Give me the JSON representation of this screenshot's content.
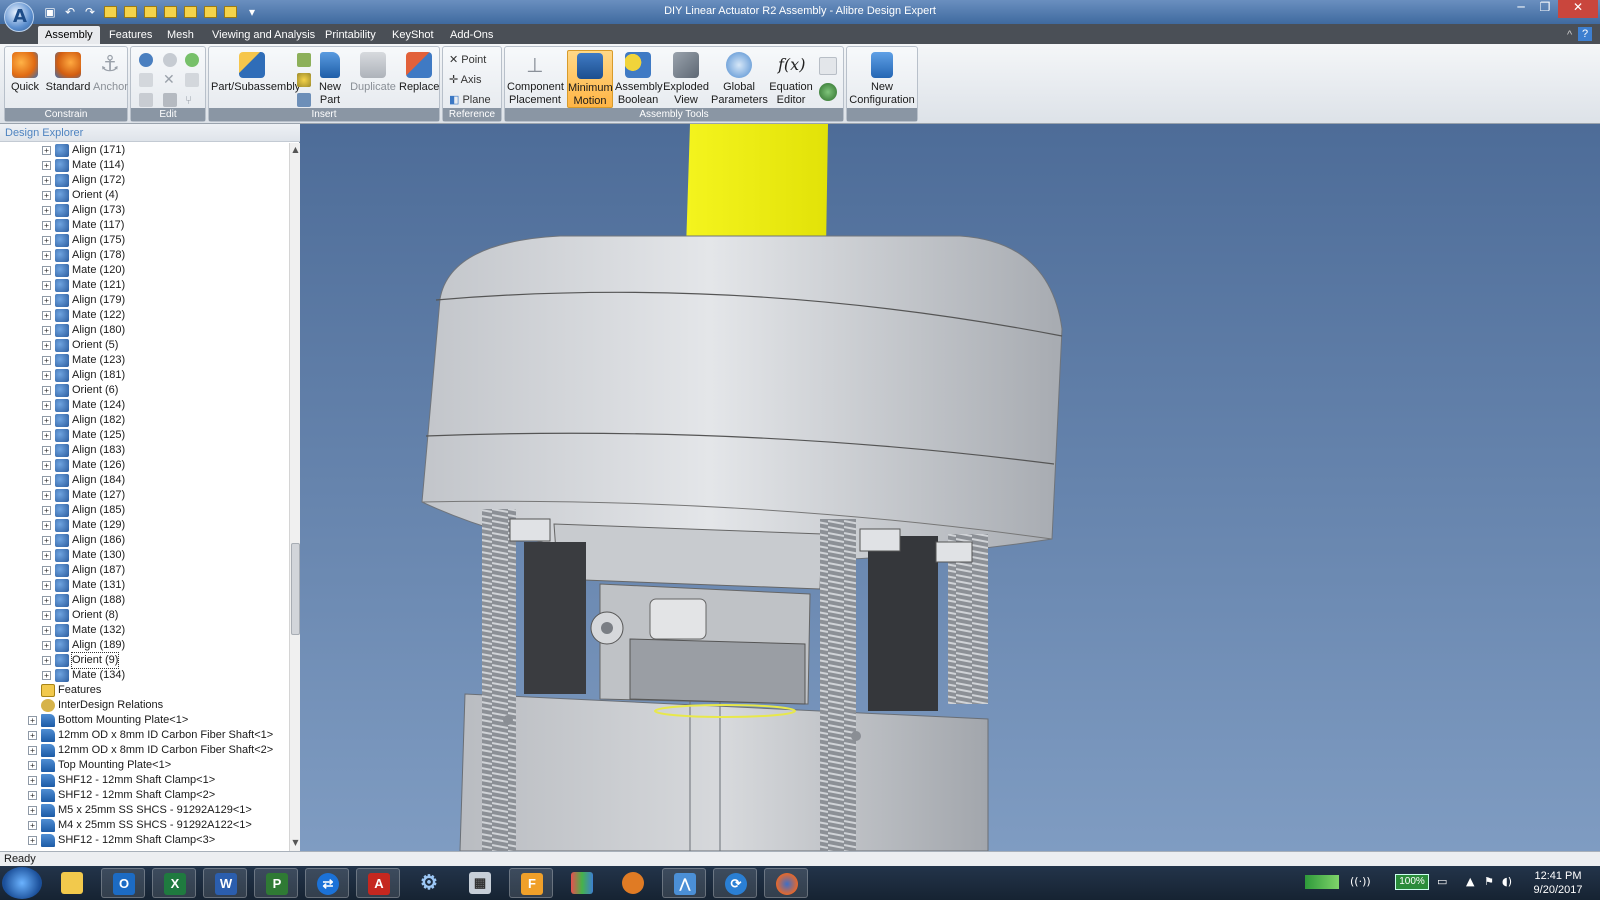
{
  "window": {
    "title": "DIY Linear Actuator R2 Assembly - Alibre Design Expert",
    "logo_icon": "alibre-logo-icon"
  },
  "menu_tabs": [
    "Assembly",
    "Features",
    "Mesh",
    "Viewing and Analysis",
    "Printability",
    "KeyShot",
    "Add-Ons"
  ],
  "active_tab": "Assembly",
  "ribbon": {
    "constrain": {
      "label": "Constrain",
      "quick": "Quick",
      "standard": "Standard",
      "anchor": "Anchor"
    },
    "edit": {
      "label": "Edit"
    },
    "insert": {
      "label": "Insert",
      "part_subassembly": "Part/Subassembly",
      "new_part_1": "New",
      "new_part_2": "Part",
      "duplicate": "Duplicate",
      "replace": "Replace"
    },
    "reference": {
      "label": "Reference",
      "point": "Point",
      "axis": "Axis",
      "plane": "Plane"
    },
    "assembly_tools": {
      "label": "Assembly Tools",
      "component_placement_1": "Component",
      "component_placement_2": "Placement",
      "minimum_motion_1": "Minimum",
      "minimum_motion_2": "Motion",
      "assembly_boolean_1": "Assembly",
      "assembly_boolean_2": "Boolean",
      "exploded_view_1": "Exploded",
      "exploded_view_2": "View",
      "global_parameters_1": "Global",
      "global_parameters_2": "Parameters",
      "equation_editor_1": "Equation",
      "equation_editor_2": "Editor",
      "equation_symbol": "f(x)"
    },
    "configuration": {
      "new_configuration_1": "New",
      "new_configuration_2": "Configuration"
    }
  },
  "explorer": {
    "title": "Design Explorer",
    "constraints": [
      "Align (171)",
      "Mate (114)",
      "Align (172)",
      "Orient (4)",
      "Align (173)",
      "Mate (117)",
      "Align (175)",
      "Align (178)",
      "Mate (120)",
      "Mate (121)",
      "Align (179)",
      "Mate (122)",
      "Align (180)",
      "Orient (5)",
      "Mate (123)",
      "Align (181)",
      "Orient (6)",
      "Mate (124)",
      "Align (182)",
      "Mate (125)",
      "Align (183)",
      "Mate (126)",
      "Align (184)",
      "Mate (127)",
      "Align (185)",
      "Mate (129)",
      "Align (186)",
      "Mate (130)",
      "Align (187)",
      "Mate (131)",
      "Align (188)",
      "Orient (8)",
      "Mate (132)",
      "Align (189)",
      "Orient (9)",
      "Mate (134)"
    ],
    "selected_constraint": "Orient (9)",
    "folders": [
      "Features",
      "InterDesign Relations"
    ],
    "parts": [
      "Bottom Mounting Plate<1>",
      "12mm OD x 8mm ID Carbon Fiber Shaft<1>",
      "12mm OD x 8mm ID Carbon Fiber Shaft<2>",
      "Top Mounting Plate<1>",
      "SHF12 - 12mm Shaft Clamp<1>",
      "SHF12 - 12mm Shaft Clamp<2>",
      "M5 x 25mm SS SHCS - 91292A129<1>",
      "M4 x 25mm SS SHCS - 91292A122<1>",
      "SHF12 - 12mm Shaft Clamp<3>"
    ]
  },
  "status": {
    "text": "Ready"
  },
  "taskbar": {
    "apps": [
      "start-orb-icon",
      "file-explorer-icon",
      "outlook-icon",
      "excel-icon",
      "word-icon",
      "project-icon",
      "teamviewer-icon",
      "acrobat-icon",
      "settings-icon",
      "calculator-icon",
      "fusion-icon",
      "chart-app-icon",
      "slicer-icon",
      "alibre-icon",
      "sync-icon",
      "firefox-icon"
    ],
    "app_letters": {
      "outlook": "O",
      "excel": "X",
      "word": "W",
      "project": "P",
      "acrobat": "A",
      "fusion": "F"
    },
    "battery": "100%",
    "time": "12:41 PM",
    "date": "9/20/2017"
  },
  "colors": {
    "accent_selected": "#ffb545",
    "shaft_yellow": "#f2f20a",
    "viewport_bg": "#5d7ca6"
  }
}
